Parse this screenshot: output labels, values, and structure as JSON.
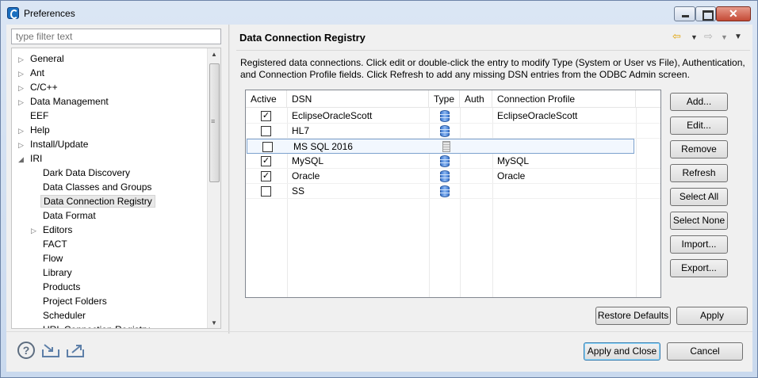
{
  "window": {
    "title": "Preferences"
  },
  "filter": {
    "placeholder": "type filter text"
  },
  "tree": [
    {
      "label": "General",
      "expandable": true,
      "depth": 0
    },
    {
      "label": "Ant",
      "expandable": true,
      "depth": 0
    },
    {
      "label": "C/C++",
      "expandable": true,
      "depth": 0
    },
    {
      "label": "Data Management",
      "expandable": true,
      "depth": 0
    },
    {
      "label": "EEF",
      "expandable": false,
      "depth": 0
    },
    {
      "label": "Help",
      "expandable": true,
      "depth": 0
    },
    {
      "label": "Install/Update",
      "expandable": true,
      "depth": 0
    },
    {
      "label": "IRI",
      "expandable": true,
      "expanded": true,
      "depth": 0
    },
    {
      "label": "Dark Data Discovery",
      "expandable": false,
      "depth": 1
    },
    {
      "label": "Data Classes and Groups",
      "expandable": false,
      "depth": 1
    },
    {
      "label": "Data Connection Registry",
      "expandable": false,
      "depth": 1,
      "selected": true
    },
    {
      "label": "Data Format",
      "expandable": false,
      "depth": 1
    },
    {
      "label": "Editors",
      "expandable": true,
      "depth": 1
    },
    {
      "label": "FACT",
      "expandable": false,
      "depth": 1
    },
    {
      "label": "Flow",
      "expandable": false,
      "depth": 1
    },
    {
      "label": "Library",
      "expandable": false,
      "depth": 1
    },
    {
      "label": "Products",
      "expandable": false,
      "depth": 1
    },
    {
      "label": "Project Folders",
      "expandable": false,
      "depth": 1
    },
    {
      "label": "Scheduler",
      "expandable": false,
      "depth": 1
    },
    {
      "label": "URL Connection Registry",
      "expandable": false,
      "depth": 1
    }
  ],
  "page": {
    "title": "Data Connection Registry",
    "description_line1": "Registered data connections. Click edit or double-click the entry to modify Type (System or User vs File), Authentication,",
    "description_line2": "and Connection Profile fields. Click Refresh to add any missing DSN entries from the ODBC Admin screen."
  },
  "table": {
    "headers": {
      "active": "Active",
      "dsn": "DSN",
      "type": "Type",
      "auth": "Auth",
      "profile": "Connection Profile"
    },
    "rows": [
      {
        "active": true,
        "dsn": "EclipseOracleScott",
        "type_icon": "database-icon",
        "auth": "",
        "profile": "EclipseOracleScott"
      },
      {
        "active": false,
        "dsn": "HL7",
        "type_icon": "database-icon",
        "auth": "",
        "profile": ""
      },
      {
        "active": false,
        "dsn": "MS SQL 2016",
        "type_icon": "file-icon",
        "auth": "",
        "profile": "",
        "selected": true
      },
      {
        "active": true,
        "dsn": "MySQL",
        "type_icon": "database-icon",
        "auth": "",
        "profile": "MySQL"
      },
      {
        "active": true,
        "dsn": "Oracle",
        "type_icon": "database-icon",
        "auth": "",
        "profile": "Oracle"
      },
      {
        "active": false,
        "dsn": "SS",
        "type_icon": "database-icon",
        "auth": "",
        "profile": ""
      }
    ]
  },
  "side_buttons": {
    "add": "Add...",
    "edit": "Edit...",
    "remove": "Remove",
    "refresh": "Refresh",
    "select_all": "Select All",
    "select_none": "Select None",
    "import": "Import...",
    "export": "Export..."
  },
  "page_buttons": {
    "restore_defaults": "Restore Defaults",
    "apply": "Apply"
  },
  "dialog_buttons": {
    "apply_and_close": "Apply and Close",
    "cancel": "Cancel"
  },
  "colors": {
    "accent": "#3c7fb1",
    "selection": "#7da2ce",
    "db_icon": "#3d78d0"
  }
}
